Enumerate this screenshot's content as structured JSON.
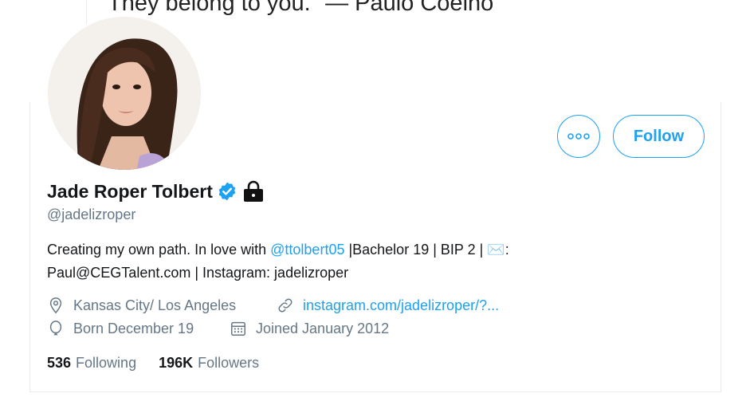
{
  "banner": {
    "quote_text": "They belong to you.\" — Paulo Coelho"
  },
  "profile": {
    "name": "Jade Roper Tolbert",
    "handle": "@jadelizroper",
    "verified": true,
    "protected_icon": "lock-icon",
    "bio": {
      "before_mention": "Creating my own path. In love with ",
      "mention": "@ttolbert05",
      "after_mention": " |Bachelor 19 | BIP 2 | ",
      "envelope_icon": "✉️",
      "after_envelope": ":",
      "line2": "Paul@CEGTalent.com | Instagram: jadelizroper"
    },
    "location": "Kansas City/ Los Angeles",
    "website": "instagram.com/jadelizroper/?...",
    "born": "Born December 19",
    "joined": "Joined January 2012"
  },
  "actions": {
    "more_label": "•••",
    "follow_label": "Follow"
  },
  "stats": {
    "following_count": "536",
    "following_label": "Following",
    "followers_count": "196K",
    "followers_label": "Followers"
  },
  "colors": {
    "accent": "#1da1f2",
    "muted": "#657786",
    "text": "#14171a"
  }
}
